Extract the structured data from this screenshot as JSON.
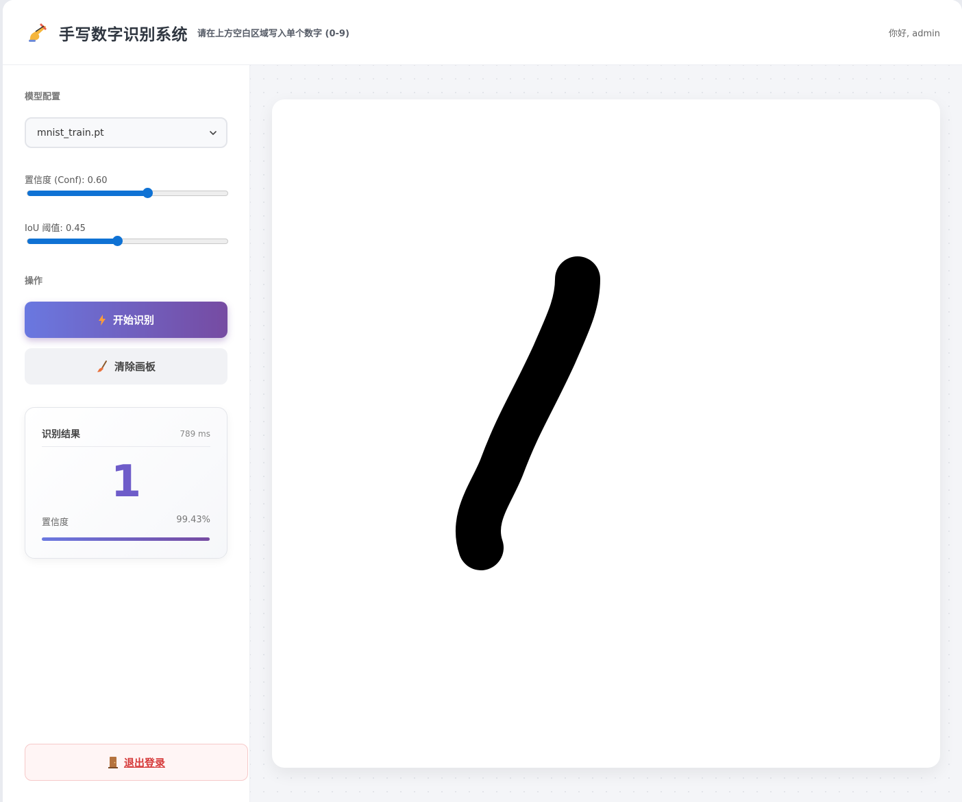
{
  "header": {
    "title": "手写数字识别系统",
    "subtitle": "请在上方空白区域写入单个数字 (0-9)",
    "greeting": "你好, admin",
    "logo_icon": "writing-hand-icon"
  },
  "sidebar": {
    "model_section_label": "模型配置",
    "model_select_value": "mnist_train.pt",
    "conf_label": "置信度 (Conf): 0.60",
    "conf_value": 0.6,
    "iou_label": "IoU 阈值: 0.45",
    "iou_value": 0.45,
    "actions_section_label": "操作",
    "start_button_label": "开始识别",
    "clear_button_label": "清除画板",
    "logout_button_label": "退出登录"
  },
  "result": {
    "title": "识别结果",
    "time": "789 ms",
    "digit": "1",
    "confidence_label": "置信度",
    "confidence_value": "99.43%",
    "confidence_fraction": 0.9943
  },
  "colors": {
    "accent_start": "#6a78e0",
    "accent_end": "#764ba2",
    "slider": "#0f72d4",
    "danger": "#d63a3a",
    "stroke": "#000000"
  }
}
